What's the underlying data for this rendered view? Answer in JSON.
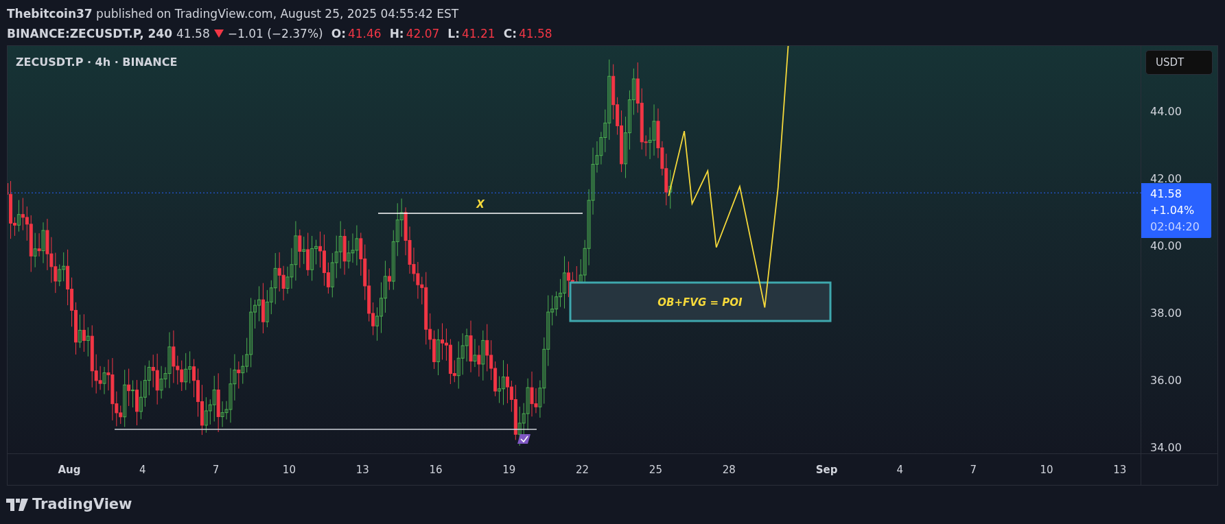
{
  "header": {
    "author": "Thebitcoin37",
    "published": "published on TradingView.com, August 25, 2025 04:55:42 EST"
  },
  "symbol_line": {
    "symbol": "BINANCE:ZECUSDT.P, 240",
    "last": "41.58",
    "falling": true,
    "change": "−1.01 (−2.37%)",
    "ohlc": [
      {
        "label": "O:",
        "value": "41.46"
      },
      {
        "label": "H:",
        "value": "42.07"
      },
      {
        "label": "L:",
        "value": "41.21"
      },
      {
        "label": "C:",
        "value": "41.58"
      }
    ]
  },
  "chart": {
    "legend": "ZECUSDT.P · 4h · BINANCE",
    "currency": "USDT",
    "price_ticks": [
      "44.00",
      "42.00",
      "40.00",
      "38.00",
      "36.00",
      "34.00"
    ],
    "time_ticks": [
      "Aug",
      "4",
      "7",
      "10",
      "13",
      "16",
      "19",
      "22",
      "25",
      "28",
      "Sep",
      "4",
      "7",
      "10",
      "13"
    ],
    "price_label": {
      "price": "41.58",
      "change": "+1.04%",
      "countdown": "02:04:20"
    },
    "annotations": [
      {
        "kind": "label",
        "text": "X"
      },
      {
        "kind": "zone",
        "text": "OB+FVG = POI"
      }
    ]
  },
  "footer": {
    "logo": "TradingView"
  }
}
